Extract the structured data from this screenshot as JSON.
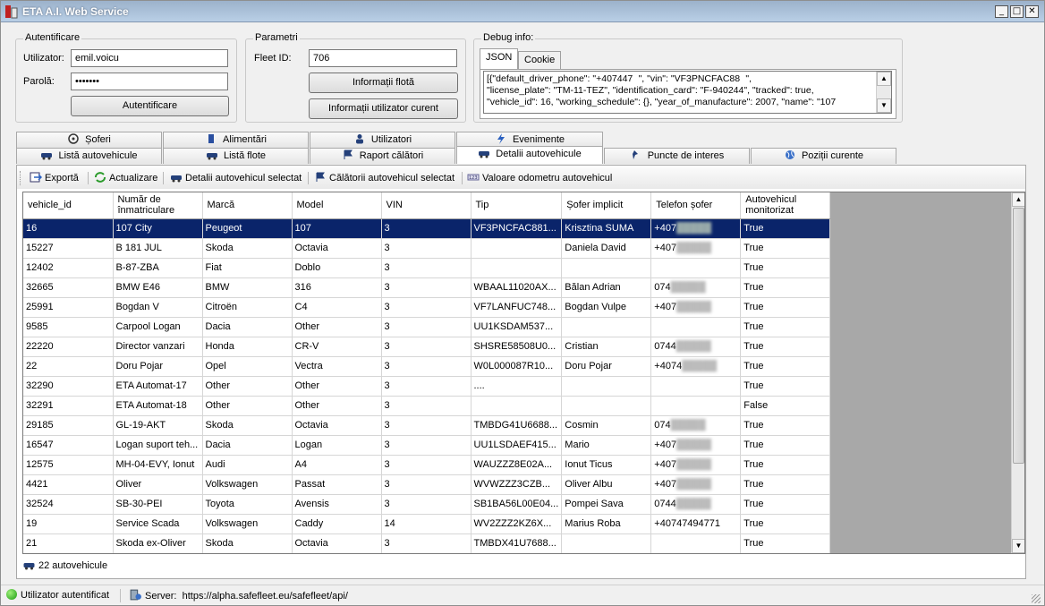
{
  "window": {
    "title": "ETA A.I. Web Service",
    "minimize": "_",
    "maximize": "□",
    "close": "✕"
  },
  "auth": {
    "group_label": "Autentificare",
    "user_label": "Utilizator:",
    "user_value": "emil.voicu",
    "password_label": "Parolă:",
    "password_value": "•••••••",
    "login_button": "Autentificare"
  },
  "params": {
    "group_label": "Parametri",
    "fleet_label": "Fleet ID:",
    "fleet_value": "706",
    "fleet_info_button": "Informații flotă",
    "user_info_button": "Informații utilizator curent"
  },
  "debug": {
    "group_label": "Debug info:",
    "tabs": [
      "JSON",
      "Cookie"
    ],
    "json_lines": [
      "[{\"default_driver_phone\": \"+407447   \", \"vin\": \"VF3PNCFAC88   \",",
      "\"license_plate\": \"TM-11-TEZ\", \"identification_card\": \"F-940244\", \"tracked\": true,",
      "\"vehicle_id\": 16, \"working_schedule\": {}, \"year_of_manufacture\": 2007, \"name\": \"107"
    ]
  },
  "tabs_row1": [
    "Șoferi",
    "Alimentări",
    "Utilizatori",
    "Evenimente"
  ],
  "tabs_row2": [
    "Listă autovehicule",
    "Listă flote",
    "Raport călători",
    "Detalii autovehicule",
    "Puncte de interes",
    "Poziții curente"
  ],
  "toolbar": {
    "export": "Exportă",
    "refresh": "Actualizare",
    "vehicle_details": "Detalii autovehicul selectat",
    "vehicle_trips": "Călătorii autovehicul selectat",
    "odometer": "Valoare odometru autovehicul"
  },
  "grid": {
    "columns": [
      "vehicle_id",
      "Număr de înmatriculare",
      "Marcă",
      "Model",
      "VIN",
      "Tip",
      "Șofer implicit",
      "Telefon șofer",
      "Autovehicul monitorizat"
    ],
    "rows": [
      [
        "16",
        "107 City",
        "Peugeot",
        "107",
        "3",
        "VF3PNCFAC881...",
        "Krisztina SUMA",
        "+407",
        "True"
      ],
      [
        "15227",
        "B 181 JUL",
        "Skoda",
        "Octavia",
        "3",
        "",
        "Daniela David",
        "+407",
        "True"
      ],
      [
        "12402",
        "B-87-ZBA",
        "Fiat",
        "Doblo",
        "3",
        "",
        "",
        "",
        "True"
      ],
      [
        "32665",
        "BMW E46",
        "BMW",
        "316",
        "3",
        "WBAAL11020AX...",
        "Bălan Adrian",
        "074",
        "True"
      ],
      [
        "25991",
        "Bogdan V",
        "Citroën",
        "C4",
        "3",
        "VF7LANFUC748...",
        "Bogdan Vulpe",
        "+407",
        "True"
      ],
      [
        "9585",
        "Carpool Logan",
        "Dacia",
        "Other",
        "3",
        "UU1KSDAM537...",
        "",
        "",
        "True"
      ],
      [
        "22220",
        "Director vanzari",
        "Honda",
        "CR-V",
        "3",
        "SHSRE58508U0...",
        "Cristian",
        "0744",
        "True"
      ],
      [
        "22",
        "Doru Pojar",
        "Opel",
        "Vectra",
        "3",
        "W0L000087R10...",
        "Doru Pojar",
        "+4074",
        "True"
      ],
      [
        "32290",
        "ETA Automat-17",
        "Other",
        "Other",
        "3",
        "....",
        "",
        "",
        "True"
      ],
      [
        "32291",
        "ETA Automat-18",
        "Other",
        "Other",
        "3",
        "",
        "",
        "",
        "False"
      ],
      [
        "29185",
        "GL-19-AKT",
        "Skoda",
        "Octavia",
        "3",
        "TMBDG41U6688...",
        "Cosmin",
        "074",
        "True"
      ],
      [
        "16547",
        "Logan suport teh...",
        "Dacia",
        "Logan",
        "3",
        "UU1LSDAEF415...",
        "Mario",
        "+407",
        "True"
      ],
      [
        "12575",
        "MH-04-EVY, Ionut",
        "Audi",
        "A4",
        "3",
        "WAUZZZ8E02A...",
        "Ionut Ticus",
        "+407",
        "True"
      ],
      [
        "4421",
        "Oliver",
        "Volkswagen",
        "Passat",
        "3",
        "WVWZZZ3CZB...",
        "Oliver Albu",
        "+407",
        "True"
      ],
      [
        "32524",
        "SB-30-PEI",
        "Toyota",
        "Avensis",
        "3",
        "SB1BA56L00E04...",
        "Pompei Sava",
        "0744",
        "True"
      ],
      [
        "19",
        "Service Scada",
        "Volkswagen",
        "Caddy",
        "14",
        "WV2ZZZ2KZ6X...",
        "Marius Roba",
        "+40747494771",
        "True"
      ],
      [
        "21",
        "Skoda ex-Oliver",
        "Skoda",
        "Octavia",
        "3",
        "TMBDX41U7688...",
        "",
        "",
        "True"
      ]
    ]
  },
  "footer": {
    "vehicle_count": "22 autovehicule"
  },
  "status": {
    "auth_status": "Utilizator autentificat",
    "server_label": "Server:",
    "server_url": "https://alpha.safefleet.eu/safefleet/api/"
  }
}
